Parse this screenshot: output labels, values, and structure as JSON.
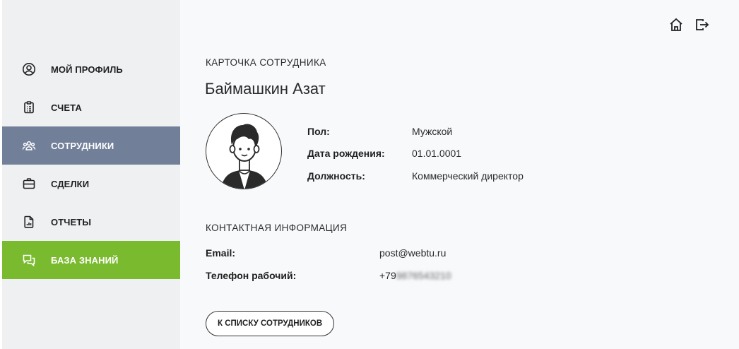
{
  "sidebar": {
    "items": [
      {
        "label": "МОЙ ПРОФИЛЬ",
        "icon": "user-circle-icon"
      },
      {
        "label": "СЧЕТА",
        "icon": "clipboard-list-icon"
      },
      {
        "label": "СОТРУДНИКИ",
        "icon": "users-icon",
        "active": true
      },
      {
        "label": "СДЕЛКИ",
        "icon": "briefcase-icon"
      },
      {
        "label": "ОТЧЕТЫ",
        "icon": "report-file-icon"
      },
      {
        "label": "БАЗА ЗНАНИЙ",
        "icon": "chat-bubbles-icon",
        "highlight": true
      }
    ],
    "active_color": "#717f99",
    "highlight_color": "#7aba2f"
  },
  "header": {
    "icons": [
      "home-icon",
      "logout-icon"
    ]
  },
  "card": {
    "section_title": "КАРТОЧКА СОТРУДНИКА",
    "name": "Баймашкин Азат",
    "fields": [
      {
        "label": "Пол:",
        "value": "Мужской"
      },
      {
        "label": "Дата рождения:",
        "value": "01.01.0001"
      },
      {
        "label": "Должность:",
        "value": "Коммерческий директор"
      }
    ]
  },
  "contacts": {
    "section_title": "КОНТАКТНАЯ ИНФОРМАЦИЯ",
    "email_label": "Email:",
    "email_value": "post@webtu.ru",
    "phone_label": "Телефон рабочий:",
    "phone_value_visible": "+79",
    "phone_value_blurred": "9876543210"
  },
  "back_button_label": "К СПИСКУ СОТРУДНИКОВ"
}
